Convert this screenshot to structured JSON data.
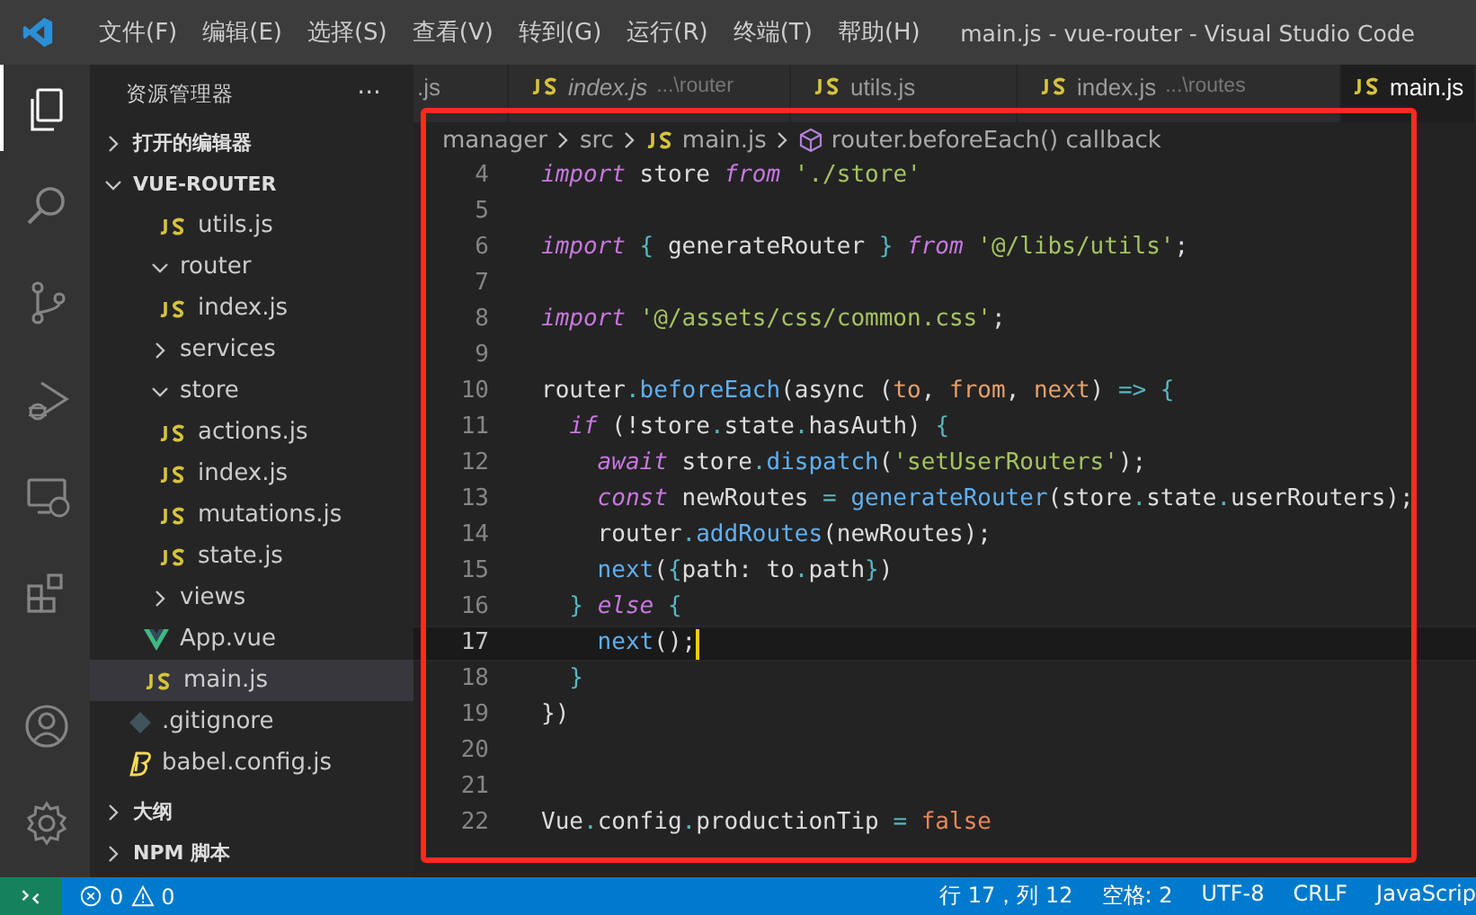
{
  "menu": [
    "文件(F)",
    "编辑(E)",
    "选择(S)",
    "查看(V)",
    "转到(G)",
    "运行(R)",
    "终端(T)",
    "帮助(H)"
  ],
  "window": {
    "title": "main.js - vue-router - Visual Studio Code"
  },
  "activity_bar": [
    {
      "kind": "files",
      "selected": true
    },
    {
      "kind": "search",
      "selected": false
    },
    {
      "kind": "source-control",
      "selected": false
    },
    {
      "kind": "debug",
      "selected": false
    },
    {
      "kind": "remote",
      "selected": false
    },
    {
      "kind": "extensions",
      "selected": false
    },
    {
      "kind": "account",
      "selected": false
    },
    {
      "kind": "settings",
      "selected": false
    }
  ],
  "sidebar": {
    "title": "资源管理器",
    "more": "···",
    "sections_top": [
      {
        "label": "打开的编辑器",
        "expanded": false
      },
      {
        "label": "VUE-ROUTER",
        "expanded": true
      }
    ],
    "tree": [
      {
        "kind": "group",
        "children": [
          {
            "kind": "group",
            "children": [
              {
                "kind": "js",
                "label": "utils.js",
                "selected": false
              }
            ]
          },
          {
            "kind": "folder",
            "label": "router",
            "expanded": true,
            "children": [
              {
                "kind": "js",
                "label": "index.js",
                "selected": false
              }
            ]
          },
          {
            "kind": "folder",
            "label": "services",
            "expanded": false
          },
          {
            "kind": "folder",
            "label": "store",
            "expanded": true,
            "children": [
              {
                "kind": "js",
                "label": "actions.js",
                "selected": false
              },
              {
                "kind": "js",
                "label": "index.js",
                "selected": false
              },
              {
                "kind": "js",
                "label": "mutations.js",
                "selected": false
              },
              {
                "kind": "js",
                "label": "state.js",
                "selected": false
              }
            ]
          },
          {
            "kind": "folder",
            "label": "views",
            "expanded": false
          },
          {
            "kind": "vue",
            "label": "App.vue",
            "selected": false
          },
          {
            "kind": "js",
            "label": "main.js",
            "selected": true
          }
        ]
      },
      {
        "kind": "git",
        "label": ".gitignore",
        "selected": false
      },
      {
        "kind": "babel",
        "label": "babel.config.js",
        "selected": false
      }
    ],
    "sections_bottom": [
      {
        "label": "大纲",
        "expanded": false
      },
      {
        "label": "NPM 脚本",
        "expanded": false
      }
    ]
  },
  "tabs": [
    {
      "label": ".js",
      "selected": false,
      "preview": false
    },
    {
      "label": "index.js",
      "description": "...\\router",
      "selected": false,
      "preview": true
    },
    {
      "label": "utils.js",
      "selected": false,
      "preview": false
    },
    {
      "label": "index.js",
      "description": "...\\routes",
      "selected": false,
      "preview": false
    },
    {
      "label": "main.js",
      "selected": true,
      "preview": false
    }
  ],
  "breadcrumb": [
    {
      "kind": "folder",
      "label": "manager"
    },
    {
      "kind": "folder",
      "label": "src"
    },
    {
      "kind": "js",
      "label": "main.js"
    },
    {
      "kind": "symbol",
      "label": "router.beforeEach() callback"
    }
  ],
  "code": [
    {
      "number": "4",
      "tokens": [
        {
          "text": "import",
          "kind": "keyword"
        },
        {
          "text": " store ",
          "kind": "plain"
        },
        {
          "text": "from",
          "kind": "keyword"
        },
        {
          "text": " './store'",
          "kind": "string"
        }
      ]
    },
    {
      "number": "5"
    },
    {
      "number": "6",
      "tokens": [
        {
          "text": "import",
          "kind": "keyword"
        },
        {
          "text": " { ",
          "kind": "punct"
        },
        {
          "text": "generateRouter",
          "kind": "plain"
        },
        {
          "text": " } ",
          "kind": "punct"
        },
        {
          "text": "from",
          "kind": "keyword"
        },
        {
          "text": " '@/libs/utils'",
          "kind": "string"
        },
        {
          "text": ";",
          "kind": "plain"
        }
      ]
    },
    {
      "number": "7"
    },
    {
      "number": "8",
      "tokens": [
        {
          "text": "import",
          "kind": "keyword"
        },
        {
          "text": " '@/assets/css/common.css'",
          "kind": "string"
        },
        {
          "text": ";",
          "kind": "plain"
        }
      ]
    },
    {
      "number": "9"
    },
    {
      "number": "10",
      "tokens": [
        {
          "text": "router",
          "kind": "plain"
        },
        {
          "text": ".",
          "kind": "punct"
        },
        {
          "text": "beforeEach",
          "kind": "function"
        },
        {
          "text": "(async (",
          "kind": "plain"
        },
        {
          "text": "to",
          "kind": "param"
        },
        {
          "text": ", ",
          "kind": "plain"
        },
        {
          "text": "from",
          "kind": "param"
        },
        {
          "text": ", ",
          "kind": "plain"
        },
        {
          "text": "next",
          "kind": "param"
        },
        {
          "text": ") ",
          "kind": "plain"
        },
        {
          "text": "=> {",
          "kind": "punct"
        }
      ]
    },
    {
      "number": "11",
      "tokens": [
        {
          "text": "  if",
          "kind": "keyword"
        },
        {
          "text": " (!store",
          "kind": "plain"
        },
        {
          "text": ".",
          "kind": "punct"
        },
        {
          "text": "state",
          "kind": "plain"
        },
        {
          "text": ".",
          "kind": "punct"
        },
        {
          "text": "hasAuth) ",
          "kind": "plain"
        },
        {
          "text": "{",
          "kind": "punct"
        }
      ]
    },
    {
      "number": "12",
      "tokens": [
        {
          "text": "    await",
          "kind": "keyword"
        },
        {
          "text": " store",
          "kind": "plain"
        },
        {
          "text": ".",
          "kind": "punct"
        },
        {
          "text": "dispatch",
          "kind": "function"
        },
        {
          "text": "(",
          "kind": "plain"
        },
        {
          "text": "'setUserRouters'",
          "kind": "string"
        },
        {
          "text": ");",
          "kind": "plain"
        }
      ]
    },
    {
      "number": "13",
      "tokens": [
        {
          "text": "    const",
          "kind": "keyword"
        },
        {
          "text": " newRoutes ",
          "kind": "plain"
        },
        {
          "text": "=",
          "kind": "punct"
        },
        {
          "text": " generateRouter",
          "kind": "function"
        },
        {
          "text": "(store",
          "kind": "plain"
        },
        {
          "text": ".",
          "kind": "punct"
        },
        {
          "text": "state",
          "kind": "plain"
        },
        {
          "text": ".",
          "kind": "punct"
        },
        {
          "text": "userRouters);",
          "kind": "plain"
        }
      ]
    },
    {
      "number": "14",
      "tokens": [
        {
          "text": "    router",
          "kind": "plain"
        },
        {
          "text": ".",
          "kind": "punct"
        },
        {
          "text": "addRoutes",
          "kind": "function"
        },
        {
          "text": "(newRoutes);",
          "kind": "plain"
        }
      ]
    },
    {
      "number": "15",
      "tokens": [
        {
          "text": "    next",
          "kind": "function"
        },
        {
          "text": "(",
          "kind": "plain"
        },
        {
          "text": "{",
          "kind": "punct"
        },
        {
          "text": "path: to",
          "kind": "plain"
        },
        {
          "text": ".",
          "kind": "punct"
        },
        {
          "text": "path",
          "kind": "plain"
        },
        {
          "text": "}",
          "kind": "punct"
        },
        {
          "text": ")",
          "kind": "plain"
        }
      ]
    },
    {
      "number": "16",
      "tokens": [
        {
          "text": "  } ",
          "kind": "punct"
        },
        {
          "text": "else",
          "kind": "keyword"
        },
        {
          "text": " {",
          "kind": "punct"
        }
      ]
    },
    {
      "number": "17",
      "current": true,
      "tokens": [
        {
          "text": "    next",
          "kind": "function"
        },
        {
          "text": "();",
          "kind": "plain"
        }
      ]
    },
    {
      "number": "18",
      "tokens": [
        {
          "text": "  }",
          "kind": "punct"
        }
      ]
    },
    {
      "number": "19",
      "tokens": [
        {
          "text": "})",
          "kind": "plain"
        }
      ]
    },
    {
      "number": "20"
    },
    {
      "number": "21"
    },
    {
      "number": "22",
      "tokens": [
        {
          "text": "Vue",
          "kind": "plain"
        },
        {
          "text": ".",
          "kind": "punct"
        },
        {
          "text": "config",
          "kind": "plain"
        },
        {
          "text": ".",
          "kind": "punct"
        },
        {
          "text": "productionTip ",
          "kind": "plain"
        },
        {
          "text": "=",
          "kind": "punct"
        },
        {
          "text": " false",
          "kind": "boolean"
        }
      ]
    }
  ],
  "status_bar": {
    "errors": "0",
    "warnings": "0",
    "right": [
      "行 17，列 12",
      "空格: 2",
      "UTF-8",
      "CRLF",
      "JavaScrip"
    ]
  }
}
